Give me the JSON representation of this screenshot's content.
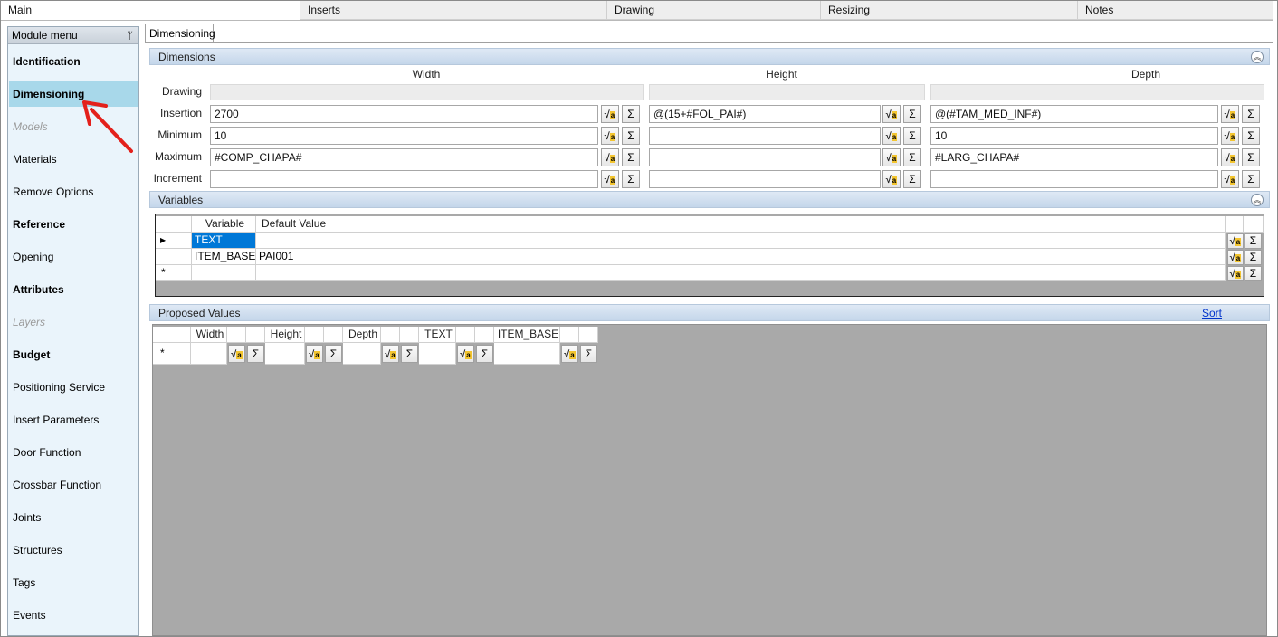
{
  "top_tabs": [
    "Main",
    "Inserts",
    "Drawing",
    "Resizing",
    "Notes"
  ],
  "sidebar": {
    "header": "Module menu",
    "items": [
      {
        "label": "Identification"
      },
      {
        "label": "Dimensioning"
      },
      {
        "label": "Models"
      },
      {
        "label": "Materials"
      },
      {
        "label": "Remove Options"
      },
      {
        "label": "Reference"
      },
      {
        "label": "Opening"
      },
      {
        "label": "Attributes"
      },
      {
        "label": "Layers"
      },
      {
        "label": "Budget"
      },
      {
        "label": "Positioning Service"
      },
      {
        "label": "Insert Parameters"
      },
      {
        "label": "Door Function"
      },
      {
        "label": "Crossbar Function"
      },
      {
        "label": "Joints"
      },
      {
        "label": "Structures"
      },
      {
        "label": "Tags"
      },
      {
        "label": "Events"
      }
    ]
  },
  "main_tab": "Dimensioning",
  "dimensions": {
    "title": "Dimensions",
    "columns": [
      "Width",
      "Height",
      "Depth"
    ],
    "rows": [
      {
        "label": "Drawing",
        "values": [
          "",
          "",
          ""
        ]
      },
      {
        "label": "Insertion",
        "values": [
          "2700",
          "@(15+#FOL_PAI#)",
          "@(#TAM_MED_INF#)"
        ]
      },
      {
        "label": "Minimum",
        "values": [
          "10",
          "",
          "10"
        ]
      },
      {
        "label": "Maximum",
        "values": [
          "#COMP_CHAPA#",
          "",
          "#LARG_CHAPA#"
        ]
      },
      {
        "label": "Increment",
        "values": [
          "",
          "",
          ""
        ]
      }
    ]
  },
  "variables": {
    "title": "Variables",
    "headers": [
      "Variable",
      "Default Value"
    ],
    "rows": [
      {
        "variable": "TEXT",
        "default": ""
      },
      {
        "variable": "ITEM_BASE",
        "default": "PAI001"
      }
    ],
    "new_row_marker": "*",
    "current_row_marker": "▶"
  },
  "proposed": {
    "title": "Proposed Values",
    "sort_label": "Sort",
    "headers": [
      "Width",
      "Height",
      "Depth",
      "TEXT",
      "ITEM_BASE"
    ],
    "new_row_marker": "*"
  },
  "icons": {
    "formula": "sqrt-formula-icon",
    "sum": "sigma-icon",
    "pin": "pin-icon",
    "collapse": "collapse-chevron-icon"
  },
  "labels": {
    "sigma": "Σ",
    "sqrt": "√",
    "sqrt_a": "a",
    "collapse": "︽",
    "pin": "📌"
  }
}
